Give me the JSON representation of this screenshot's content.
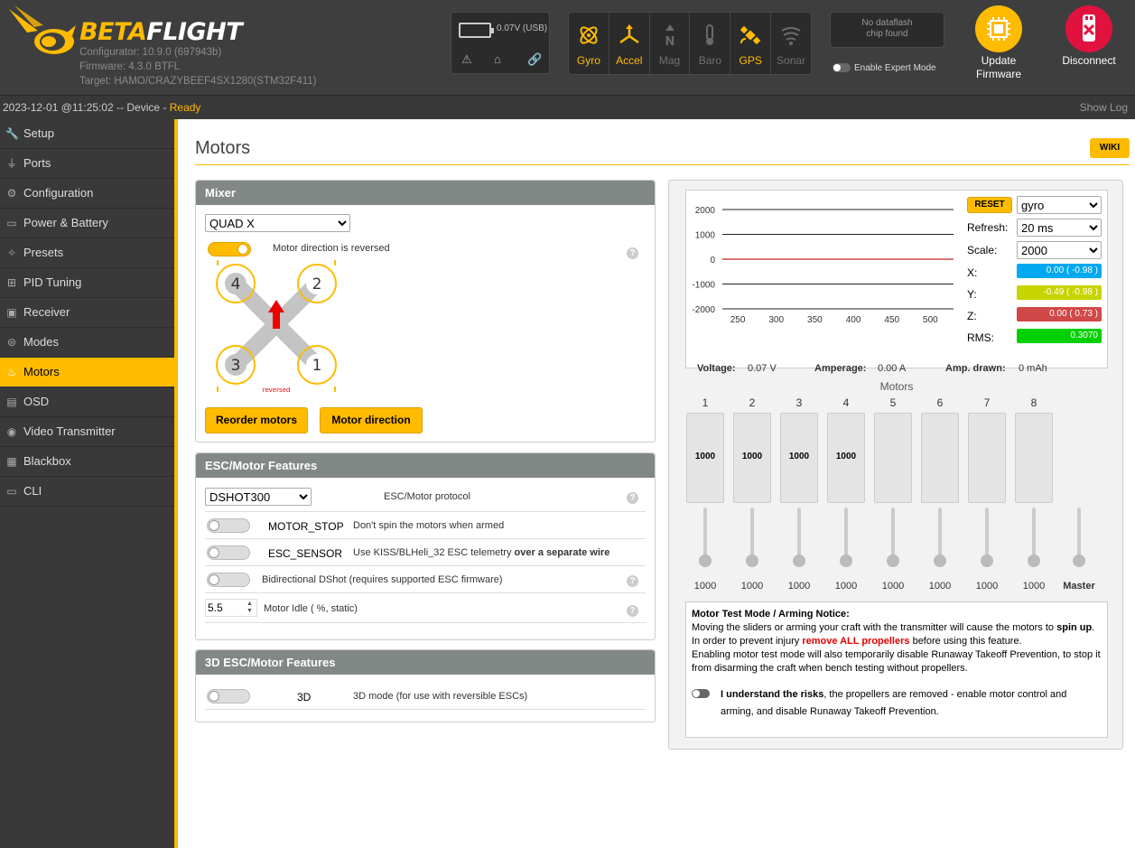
{
  "header": {
    "brand_beta": "BETA",
    "brand_flight": "FLIGHT",
    "configurator": "Configurator: 10.9.0 (697943b)",
    "firmware": "Firmware: 4.3.0 BTFL",
    "target": "Target: HAMO/CRAZYBEEF4SX1280(STM32F411)",
    "battery": "0.07V (USB)",
    "sensors": [
      {
        "label": "Gyro",
        "icon": "gyro-icon",
        "active": true
      },
      {
        "label": "Accel",
        "icon": "accel-icon",
        "active": true
      },
      {
        "label": "Mag",
        "icon": "mag-icon",
        "active": false
      },
      {
        "label": "Baro",
        "icon": "baro-icon",
        "active": false
      },
      {
        "label": "GPS",
        "icon": "gps-icon",
        "active": true
      },
      {
        "label": "Sonar",
        "icon": "sonar-icon",
        "active": false
      }
    ],
    "dataflash_line1": "No dataflash",
    "dataflash_line2": "chip found",
    "expert_mode": "Enable Expert Mode",
    "update_line1": "Update",
    "update_line2": "Firmware",
    "disconnect": "Disconnect",
    "colors": {
      "accent": "#ffbb00",
      "disconnect": "#e2123f"
    }
  },
  "status": {
    "time": "2023-12-01 @11:25:02 -- Device - ",
    "state": "Ready",
    "show_log": "Show Log"
  },
  "sidebar": {
    "items": [
      {
        "label": "Setup",
        "icon": "wrench-icon"
      },
      {
        "label": "Ports",
        "icon": "plug-icon"
      },
      {
        "label": "Configuration",
        "icon": "gear-icon"
      },
      {
        "label": "Power & Battery",
        "icon": "battery-icon"
      },
      {
        "label": "Presets",
        "icon": "presets-icon"
      },
      {
        "label": "PID Tuning",
        "icon": "pid-icon"
      },
      {
        "label": "Receiver",
        "icon": "receiver-icon"
      },
      {
        "label": "Modes",
        "icon": "modes-icon"
      },
      {
        "label": "Motors",
        "icon": "motors-icon"
      },
      {
        "label": "OSD",
        "icon": "osd-icon"
      },
      {
        "label": "Video Transmitter",
        "icon": "vtx-icon"
      },
      {
        "label": "Blackbox",
        "icon": "blackbox-icon"
      },
      {
        "label": "CLI",
        "icon": "cli-icon"
      }
    ],
    "active_index": 8
  },
  "page": {
    "title": "Motors",
    "wiki": "WIKI"
  },
  "mixer": {
    "title": "Mixer",
    "selected": "QUAD X",
    "reversed_label": "Motor direction is reversed",
    "reversed_on": true,
    "diagram_reversed": "reversed",
    "motor_labels": [
      "4",
      "2",
      "3",
      "1"
    ],
    "reorder_button": "Reorder motors",
    "direction_button": "Motor direction"
  },
  "esc": {
    "title": "ESC/Motor Features",
    "protocol": "DSHOT300",
    "protocol_label": "ESC/Motor protocol",
    "motor_stop_name": "MOTOR_STOP",
    "motor_stop_desc": "Don't spin the motors when armed",
    "esc_sensor_name": "ESC_SENSOR",
    "esc_sensor_desc": "Use KISS/BLHeli_32 ESC telemetry ",
    "esc_sensor_desc_bold": "over a separate wire",
    "bidir_desc": "Bidirectional DShot (requires supported ESC firmware)",
    "idle_value": "5.5",
    "idle_label": "Motor Idle ( %, static)"
  },
  "esc3d": {
    "title": "3D ESC/Motor Features",
    "name": "3D",
    "desc": "3D mode (for use with reversible ESCs)"
  },
  "graph": {
    "reset": "RESET",
    "sensor": "gyro",
    "refresh_label": "Refresh:",
    "refresh": "20 ms",
    "scale_label": "Scale:",
    "scale": "2000",
    "x_label": "X:",
    "x_value": "0.00 ( -0.98 )",
    "y_label": "Y:",
    "y_value": "-0.49 ( -0.98 )",
    "z_label": "Z:",
    "z_value": "0.00 ( 0.73 )",
    "rms_label": "RMS:",
    "rms_value": "0.3070",
    "voltage_label": "Voltage:",
    "voltage": "0.07 V",
    "amperage_label": "Amperage:",
    "amperage": "0.00 A",
    "drawn_label": "Amp. drawn:",
    "drawn": "0 mAh",
    "colors": {
      "x": "#00a8f0",
      "y": "#c8d400",
      "z": "#d04848",
      "rms": "#00d000"
    }
  },
  "chart_data": {
    "type": "line",
    "x": [
      250,
      300,
      350,
      400,
      450,
      500
    ],
    "ylim": [
      -2000,
      2000
    ],
    "yticks": [
      "2000",
      "1000",
      "0",
      "-1000",
      "-2000"
    ],
    "xticks": [
      "250",
      "300",
      "350",
      "400",
      "450",
      "500"
    ],
    "series": [
      {
        "values": [
          0,
          0,
          0,
          0,
          0,
          0
        ],
        "color": "#d04848"
      }
    ]
  },
  "motors": {
    "title": "Motors",
    "numbers": [
      "1",
      "2",
      "3",
      "4",
      "5",
      "6",
      "7",
      "8"
    ],
    "meter_values": [
      "1000",
      "1000",
      "1000",
      "1000",
      "",
      "",
      "",
      ""
    ],
    "slider_values": [
      "1000",
      "1000",
      "1000",
      "1000",
      "1000",
      "1000",
      "1000",
      "1000"
    ],
    "master": "Master"
  },
  "notice": {
    "title": "Motor Test Mode / Arming Notice:",
    "line1a": "Moving the sliders or arming your craft with the transmitter will cause the motors to ",
    "line1b": "spin up",
    "line2a": "In order to prevent injury ",
    "line2b": "remove ALL propellers",
    "line2c": " before using this feature.",
    "line3": "Enabling motor test mode will also temporarily disable Runaway Takeoff Prevention, to stop it from disarming the craft when bench testing without propellers.",
    "understand_bold": "I understand the risks",
    "understand_rest": ", the propellers are removed - enable motor control and arming, and disable Runaway Takeoff Prevention."
  }
}
